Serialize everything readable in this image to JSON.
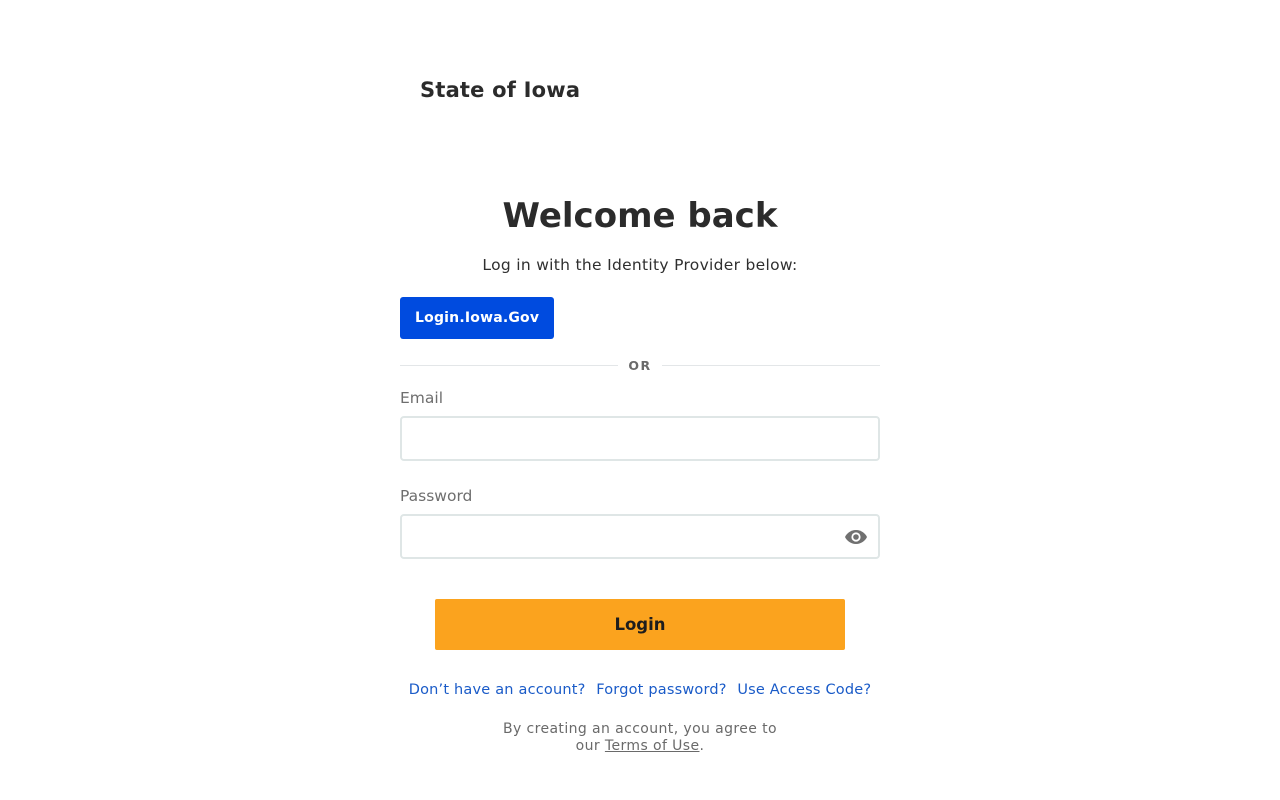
{
  "header": {
    "org_name": "State of Iowa"
  },
  "login": {
    "title": "Welcome back",
    "subtitle": "Log in with the Identity Provider below:",
    "idp_button_label": "Login.Iowa.Gov",
    "divider_text": "OR",
    "email_label": "Email",
    "email_value": "",
    "password_label": "Password",
    "password_value": "",
    "login_button_label": "Login"
  },
  "links": {
    "no_account": "Don’t have an account?",
    "forgot_password": "Forgot password?",
    "access_code": "Use Access Code?"
  },
  "terms": {
    "prefix": "By creating an account, you agree to",
    "our": "our",
    "link_label": "Terms of Use",
    "suffix": "."
  },
  "icons": {
    "password_toggle": "eye-icon"
  },
  "colors": {
    "idp_button": "#004bdf",
    "login_button": "#fba31e",
    "link": "#1a5bc8"
  }
}
